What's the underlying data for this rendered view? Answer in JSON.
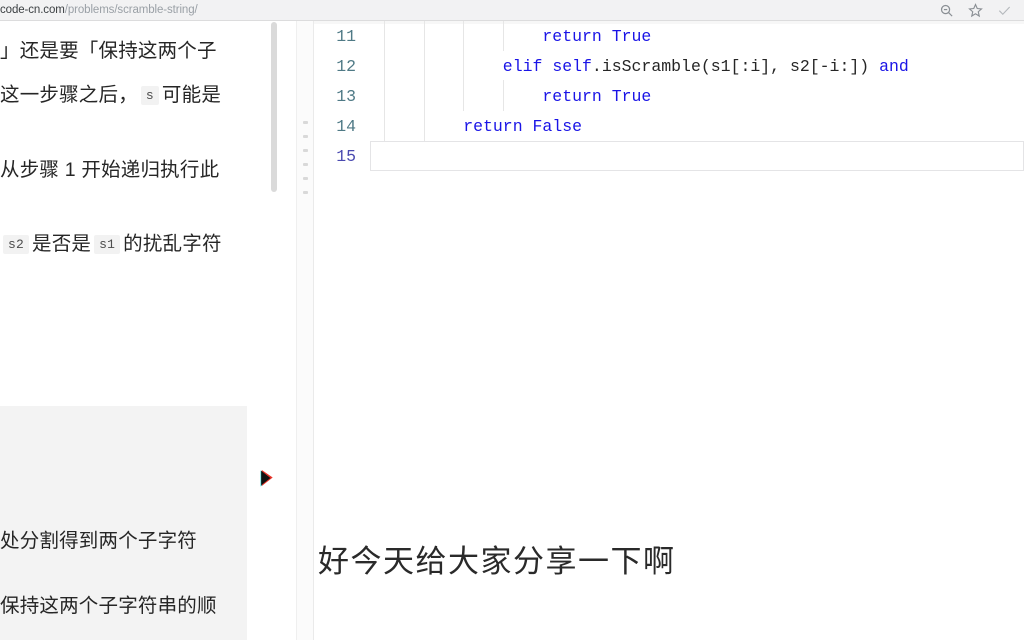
{
  "browser": {
    "url_host": "code-cn.com",
    "url_path": "/problems/scramble-string/",
    "icons": {
      "zoom": "search-zoom-icon",
      "bookmark": "star-icon",
      "check": "check-icon"
    }
  },
  "left_panel": {
    "lines": [
      "」还是要「保持这两个子",
      "这一步骤之后，",
      "可能是",
      "从步骤 1 开始递归执行此"
    ],
    "inline_code_1": "s",
    "question_prefix": "s2",
    "question_mid": "是否是",
    "question_code2": "s1",
    "question_suffix": "的扰乱字符",
    "scrollbar": "vertical-scrollbar"
  },
  "overlay_card": {
    "line1": "处分割得到两个子字符",
    "line2": "保持这两个子字符串的顺"
  },
  "editor": {
    "lines": [
      {
        "num": "11",
        "indent": 4,
        "tokens": [
          {
            "t": "return",
            "c": "kw"
          },
          {
            "t": " ",
            "c": "punc"
          },
          {
            "t": "True",
            "c": "bi"
          }
        ]
      },
      {
        "num": "12",
        "indent": 3,
        "tokens": [
          {
            "t": "elif",
            "c": "kw"
          },
          {
            "t": " ",
            "c": "punc"
          },
          {
            "t": "self",
            "c": "kw"
          },
          {
            "t": ".isScramble(s1[:i], s2[-i:]) ",
            "c": "id"
          },
          {
            "t": "and",
            "c": "kw"
          }
        ]
      },
      {
        "num": "13",
        "indent": 4,
        "tokens": [
          {
            "t": "return",
            "c": "kw"
          },
          {
            "t": " ",
            "c": "punc"
          },
          {
            "t": "True",
            "c": "bi"
          }
        ]
      },
      {
        "num": "14",
        "indent": 2,
        "tokens": [
          {
            "t": "return",
            "c": "kw"
          },
          {
            "t": " ",
            "c": "punc"
          },
          {
            "t": "False",
            "c": "bi"
          }
        ]
      },
      {
        "num": "15",
        "indent": 0,
        "tokens": []
      }
    ],
    "active_line": "15"
  },
  "subtitle": {
    "text": "好今天给大家分享一下啊"
  },
  "colors": {
    "keyword": "#1a14e6",
    "gutter": "#4f7a86",
    "chrome_bg": "#f2f2f3",
    "overlay_bg": "#f3f3f3",
    "cursor_red": "#e8352a",
    "cursor_cyan": "#19c6c6"
  }
}
